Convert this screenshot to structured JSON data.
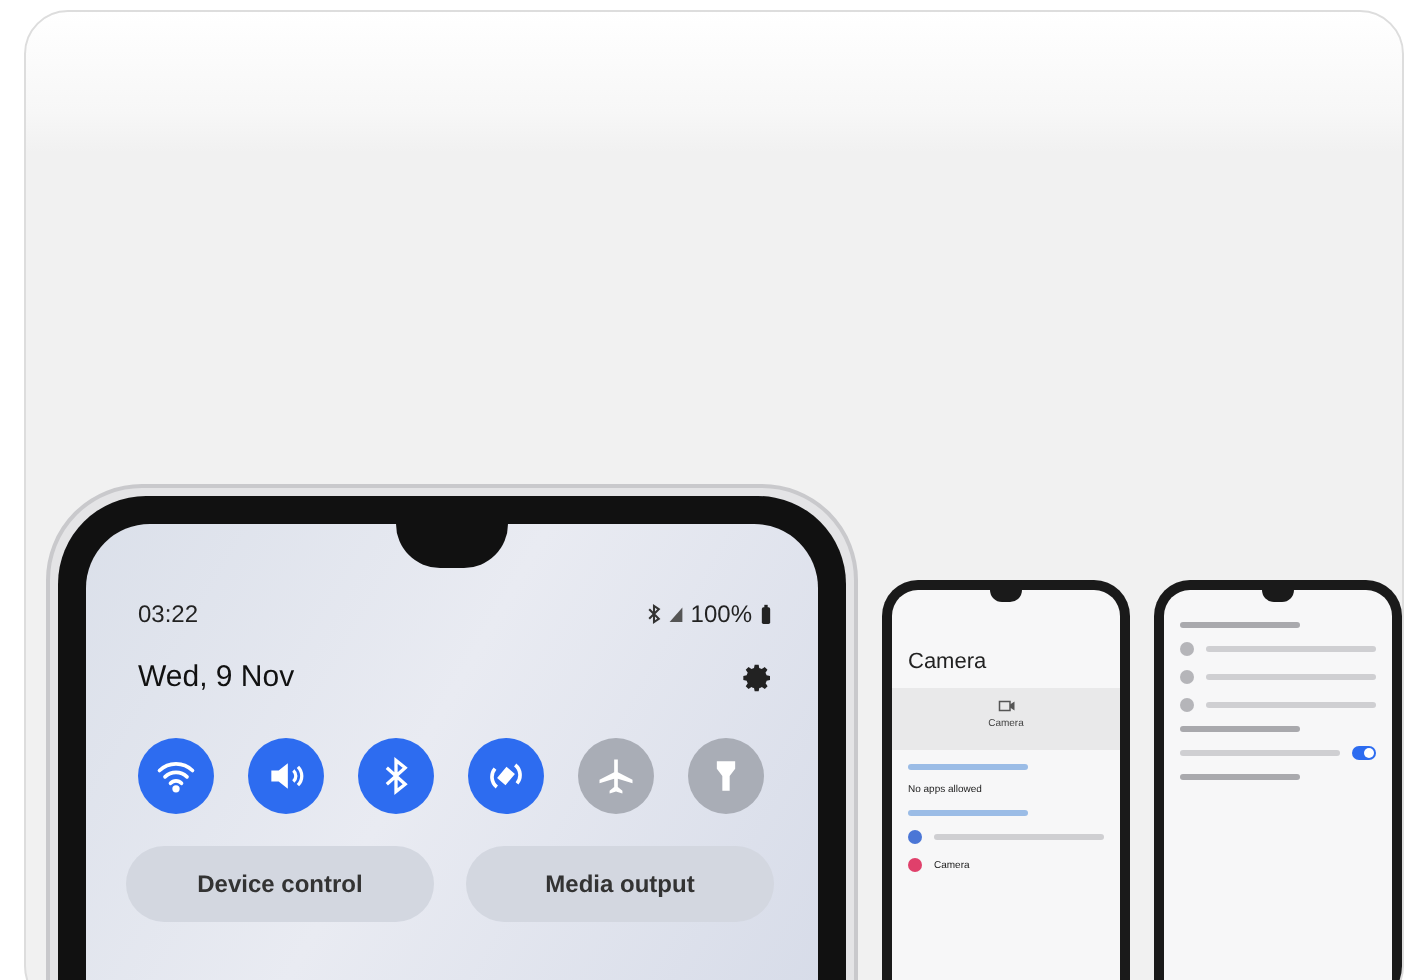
{
  "quick_panel": {
    "time": "03:22",
    "battery": "100%",
    "date": "Wed, 9 Nov",
    "tiles": [
      {
        "kind": "wifi",
        "on": true
      },
      {
        "kind": "sound",
        "on": true
      },
      {
        "kind": "bluetooth",
        "on": true
      },
      {
        "kind": "rotate",
        "on": true
      },
      {
        "kind": "airplane",
        "on": false
      },
      {
        "kind": "flashlight",
        "on": false
      }
    ],
    "buttons": [
      "Device control",
      "Media output"
    ]
  },
  "camera_screen": {
    "title": "Camera",
    "tile_label": "Camera",
    "section_value": "No apps allowed",
    "item_label": "Camera"
  },
  "privacy_screen": {
    "toggle_on": true
  }
}
